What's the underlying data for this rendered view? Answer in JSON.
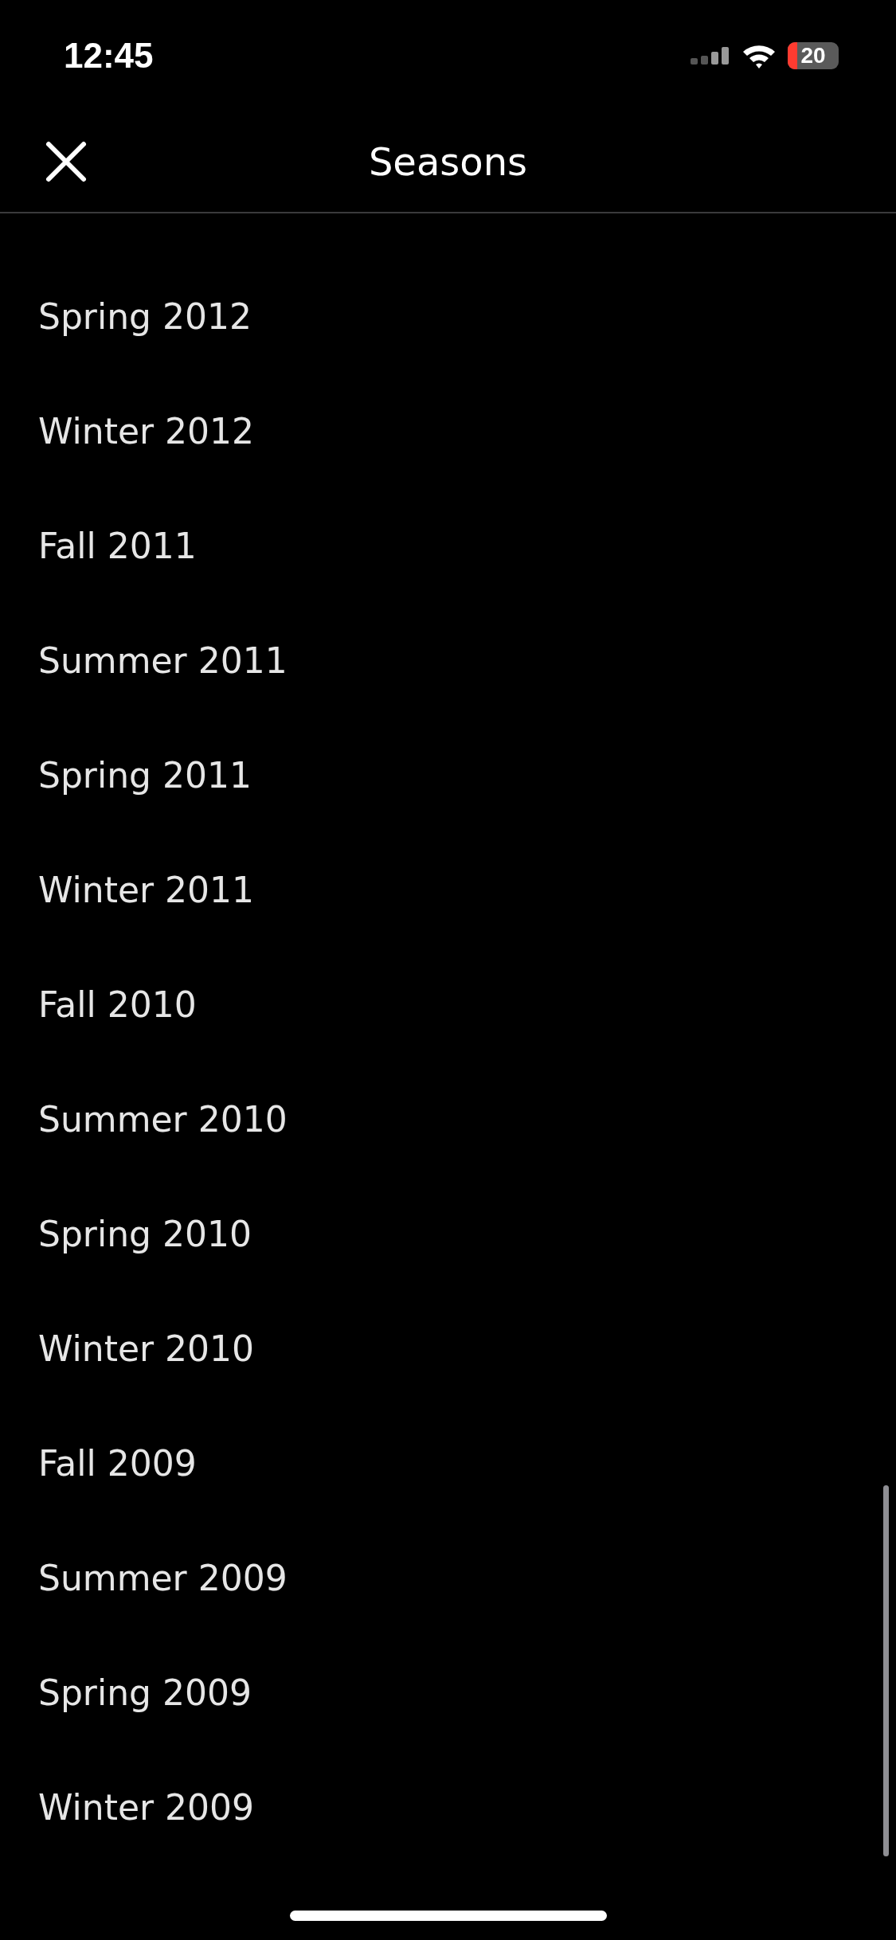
{
  "status_bar": {
    "time": "12:45",
    "battery": "20"
  },
  "header": {
    "title": "Seasons"
  },
  "seasons": [
    "Spring 2012",
    "Winter 2012",
    "Fall 2011",
    "Summer 2011",
    "Spring 2011",
    "Winter 2011",
    "Fall 2010",
    "Summer 2010",
    "Spring 2010",
    "Winter 2010",
    "Fall 2009",
    "Summer 2009",
    "Spring 2009",
    "Winter 2009"
  ]
}
